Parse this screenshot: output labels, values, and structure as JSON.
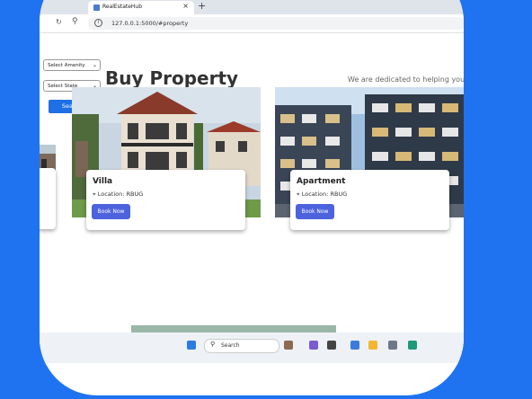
{
  "browser": {
    "tab_title": "RealEstateHub",
    "tab_close": "×",
    "new_tab": "+",
    "url": "127.0.0.1:5000/#property"
  },
  "page": {
    "title": "Buy Property",
    "tagline": "We are dedicated to helping you fi",
    "filters": {
      "amenity_label": "Select Amenity",
      "state_label": "Select State",
      "search_label": "Search"
    },
    "properties": [
      {
        "name": "Villa",
        "location": "Location: RBUG",
        "button": "Book Now"
      },
      {
        "name": "Apartment",
        "location": "Location: RBUG",
        "button": "Book Now"
      }
    ]
  },
  "taskbar": {
    "search_placeholder": "Search"
  },
  "colors": {
    "background": "#1f73f0",
    "search_button": "#1f6fe5",
    "book_button": "#4d63de"
  }
}
